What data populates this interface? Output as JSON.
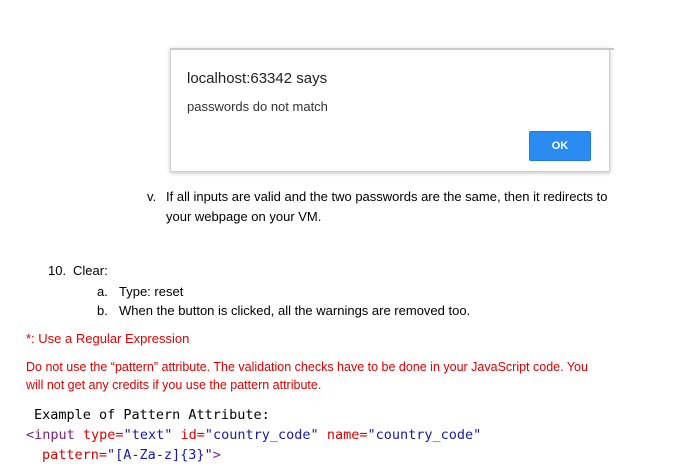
{
  "dialog": {
    "title": "localhost:63342 says",
    "message": "passwords do not match",
    "ok_label": "OK"
  },
  "item_v": {
    "marker": "v.",
    "line1": "If all inputs are valid and the two passwords are the same, then it redirects to",
    "line2": "your webpage on your VM."
  },
  "section_10": {
    "marker": "10.",
    "heading": "Clear:",
    "items": [
      {
        "marker": "a.",
        "text": "Type: reset"
      },
      {
        "marker": "b.",
        "text": "When the button is clicked, all the warnings are removed too."
      }
    ]
  },
  "notes": {
    "regex": "*: Use a Regular Expression",
    "pattern_line1": "Do not use the “pattern” attribute. The validation checks have to be done in your JavaScript code.  You",
    "pattern_line2": "will not get any credits if you use the pattern attribute."
  },
  "code_example": {
    "heading": "Example of Pattern Attribute:",
    "open_tag": "<input",
    "type_attr": "type=",
    "type_val": "\"text\"",
    "id_attr": "id=",
    "id_val": "\"country_code\"",
    "name_attr": "name=",
    "name_val": "\"country_code\"",
    "pattern_attr": "pattern=",
    "pattern_val": "\"[A-Za-z]{3}\"",
    "close_tag": ">"
  },
  "colors": {
    "ok_button": "#2a8cf0",
    "note_red": "#e00000"
  }
}
